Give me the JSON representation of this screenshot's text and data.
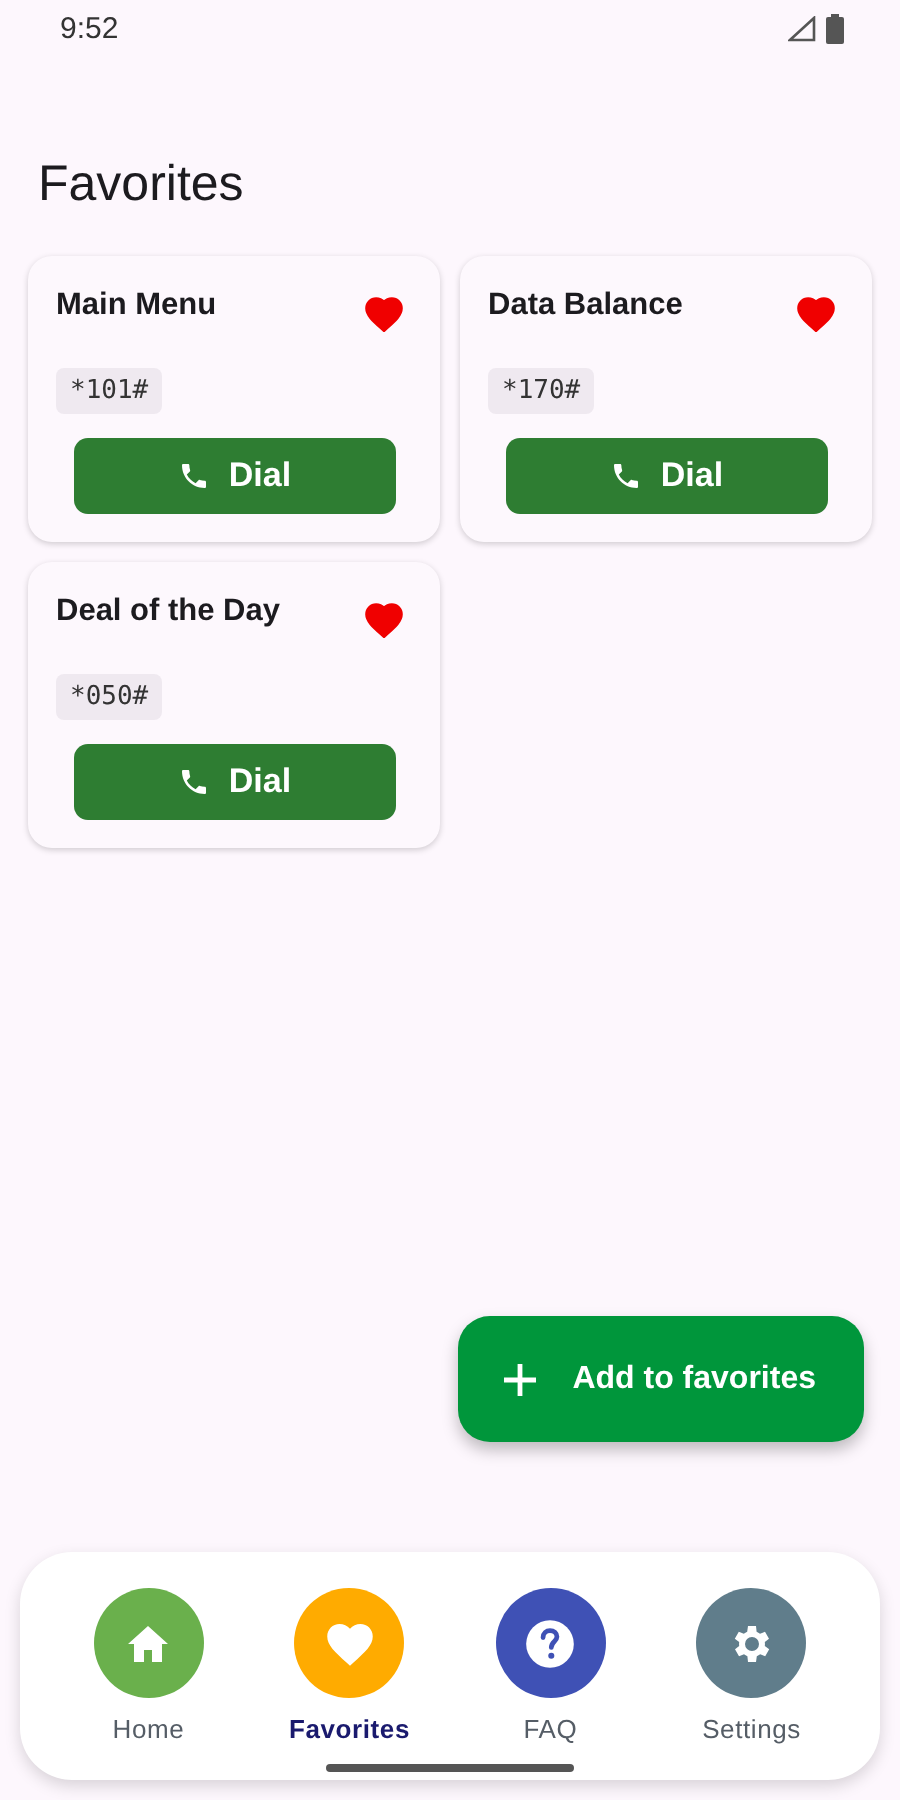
{
  "status_bar": {
    "time": "9:52"
  },
  "title": "Favorites",
  "favorites": [
    {
      "name": "Main Menu",
      "code": "*101#",
      "favorite": true,
      "button": "Dial"
    },
    {
      "name": "Data Balance",
      "code": "*170#",
      "favorite": true,
      "button": "Dial"
    },
    {
      "name": "Deal of the Day",
      "code": "*050#",
      "favorite": true,
      "button": "Dial"
    }
  ],
  "fab": {
    "label": "Add to favorites"
  },
  "nav": [
    {
      "kind": "home",
      "label": "Home",
      "color": "#6ab04c",
      "selected": false
    },
    {
      "kind": "favorites",
      "label": "Favorites",
      "color": "#ffab00",
      "selected": true
    },
    {
      "kind": "faq",
      "label": "FAQ",
      "color": "#3f51b5",
      "selected": false
    },
    {
      "kind": "settings",
      "label": "Settings",
      "color": "#607d8b",
      "selected": false
    }
  ]
}
